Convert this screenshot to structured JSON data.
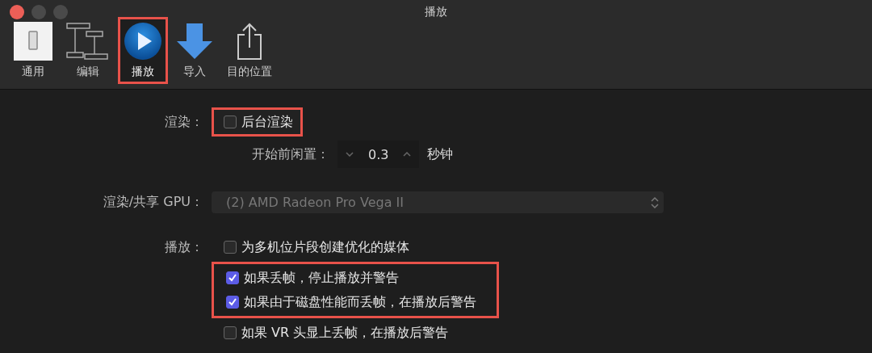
{
  "window": {
    "title": "播放"
  },
  "toolbar": [
    {
      "label": "通用",
      "kind": "general",
      "selected": false,
      "highlighted": false
    },
    {
      "label": "编辑",
      "kind": "editing",
      "selected": false,
      "highlighted": false
    },
    {
      "label": "播放",
      "kind": "playback",
      "selected": true,
      "highlighted": true
    },
    {
      "label": "导入",
      "kind": "import",
      "selected": false,
      "highlighted": false
    },
    {
      "label": "目的位置",
      "kind": "destinations",
      "selected": false,
      "highlighted": false
    }
  ],
  "render": {
    "label": "渲染：",
    "option": {
      "label": "后台渲染",
      "checked": false,
      "highlighted": true
    }
  },
  "idle": {
    "label": "开始前闲置：",
    "value": "0.3",
    "unit": "秒钟"
  },
  "gpu": {
    "label": "渲染/共享 GPU：",
    "value": "(2) AMD Radeon Pro Vega II",
    "disabled": true
  },
  "playback": {
    "label": "播放：",
    "options": [
      {
        "label": "为多机位片段创建优化的媒体",
        "checked": false,
        "highlighted": false
      },
      {
        "label": "如果丢帧，停止播放并警告",
        "checked": true,
        "highlighted": true
      },
      {
        "label": "如果由于磁盘性能而丢帧，在播放后警告",
        "checked": true,
        "highlighted": true
      },
      {
        "label": "如果 VR 头显上丢帧，在播放后警告",
        "checked": false,
        "highlighted": false
      }
    ]
  }
}
